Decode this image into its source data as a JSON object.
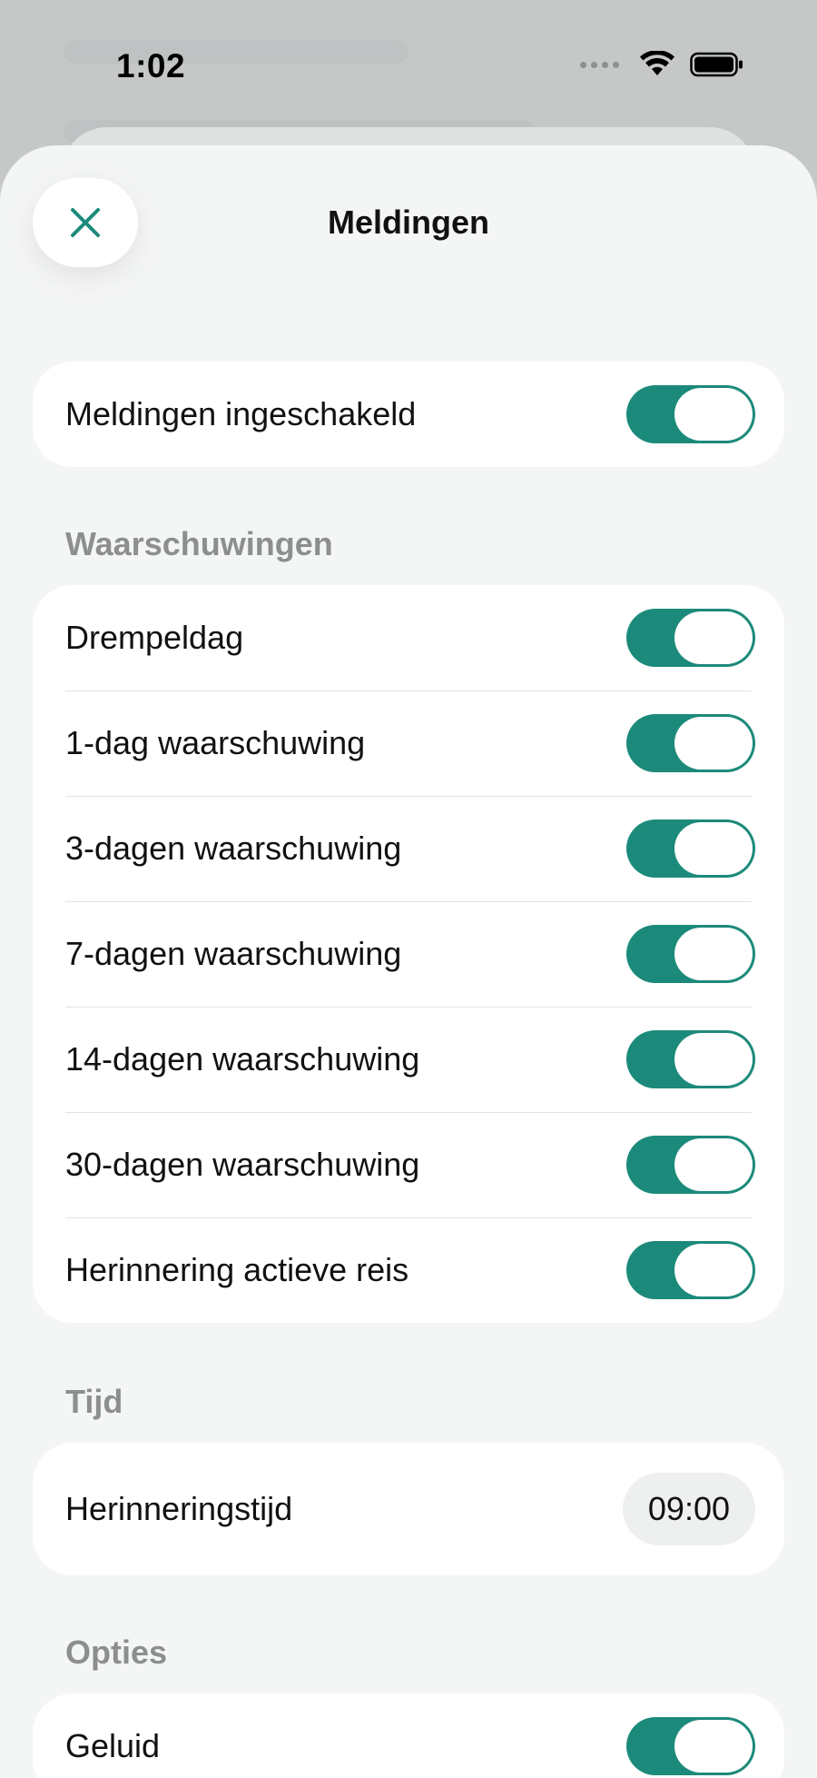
{
  "status_bar": {
    "time": "1:02"
  },
  "sheet": {
    "title": "Meldingen"
  },
  "colors": {
    "accent": "#1c8a7a",
    "section_header": "#8d8f8f",
    "sheet_background": "#f4f5f5",
    "card_background": "#ffffff"
  },
  "master": {
    "label": "Meldingen ingeschakeld",
    "enabled": true
  },
  "warnings": {
    "header": "Waarschuwingen",
    "items": [
      {
        "label": "Drempeldag",
        "enabled": true
      },
      {
        "label": "1-dag waarschuwing",
        "enabled": true
      },
      {
        "label": "3-dagen waarschuwing",
        "enabled": true
      },
      {
        "label": "7-dagen waarschuwing",
        "enabled": true
      },
      {
        "label": "14-dagen waarschuwing",
        "enabled": true
      },
      {
        "label": "30-dagen waarschuwing",
        "enabled": true
      },
      {
        "label": "Herinnering actieve reis",
        "enabled": true
      }
    ]
  },
  "time": {
    "header": "Tijd",
    "reminder_label": "Herinneringstijd",
    "reminder_value": "09:00"
  },
  "options": {
    "header": "Opties",
    "items": [
      {
        "label": "Geluid",
        "enabled": true
      }
    ]
  }
}
